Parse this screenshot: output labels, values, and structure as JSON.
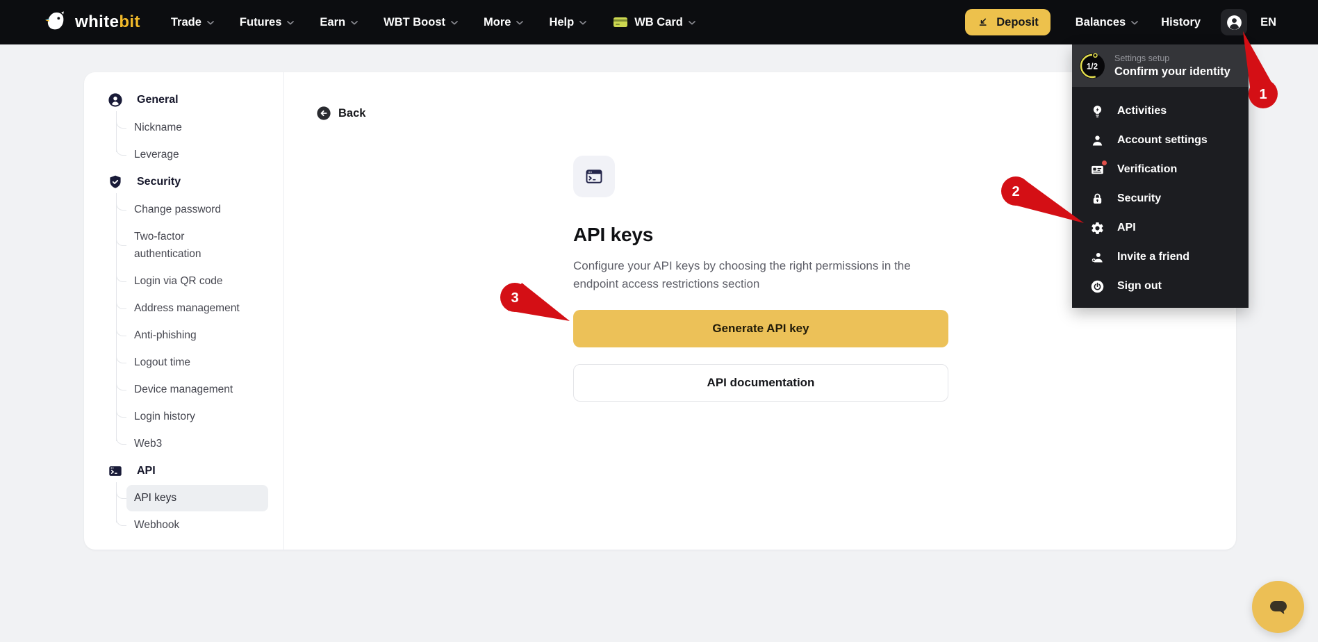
{
  "navbar": {
    "logo": {
      "white": "white",
      "bit": "bit"
    },
    "items": [
      "Trade",
      "Futures",
      "Earn",
      "WBT Boost",
      "More",
      "Help"
    ],
    "wb_card_label": "WB Card",
    "deposit_label": "Deposit",
    "balances_label": "Balances",
    "history_label": "History",
    "language": "EN"
  },
  "account_menu": {
    "progress": "1/2",
    "setup_label": "Settings setup",
    "setup_title": "Confirm your identity",
    "items": [
      {
        "label": "Activities",
        "icon": "activities-bulb-icon"
      },
      {
        "label": "Account settings",
        "icon": "person-icon"
      },
      {
        "label": "Verification",
        "icon": "id-card-icon",
        "badge": true
      },
      {
        "label": "Security",
        "icon": "lock-icon"
      },
      {
        "label": "API",
        "icon": "gear-icon"
      },
      {
        "label": "Invite a friend",
        "icon": "invite-friend-icon"
      },
      {
        "label": "Sign out",
        "icon": "power-icon"
      }
    ]
  },
  "sidebar": {
    "sections": [
      {
        "label": "General",
        "icon": "person-circle-icon",
        "children": [
          "Nickname",
          "Leverage"
        ]
      },
      {
        "label": "Security",
        "icon": "shield-check-icon",
        "children": [
          "Change password",
          "Two-factor authentication",
          "Login via QR code",
          "Address management",
          "Anti-phishing",
          "Logout time",
          "Device management",
          "Login history",
          "Web3"
        ]
      },
      {
        "label": "API",
        "icon": "terminal-icon",
        "children": [
          "API keys",
          "Webhook"
        ],
        "active_child": "API keys"
      }
    ]
  },
  "main": {
    "back_label": "Back",
    "title": "API keys",
    "description": "Configure your API keys by choosing the right permissions in the endpoint access restrictions section",
    "primary_button": "Generate API key",
    "secondary_button": "API documentation"
  },
  "annotations": {
    "step1": "1",
    "step2": "2",
    "step3": "3"
  },
  "icons": {
    "logo-bird-icon": "bird glyph",
    "chevron-down-icon": "⌄",
    "wb-card-icon": "card",
    "deposit-arrow-icon": "↙",
    "user-avatar-icon": "person",
    "activities-bulb-icon": "bulb+bolt",
    "person-icon": "person",
    "id-card-icon": "id card",
    "lock-icon": "padlock",
    "gear-icon": "⚙",
    "invite-friend-icon": "person+",
    "power-icon": "⏻",
    "person-circle-icon": "person in circle",
    "shield-check-icon": "shield ✓",
    "terminal-icon": ">_",
    "terminal-window-icon": ">_ window",
    "back-arrow-icon": "←",
    "chat-bubble-icon": "speech bubble"
  },
  "colors": {
    "accent_yellow": "#ECC158",
    "deposit_yellow": "#EDC14C",
    "annotation_red": "#D40F15",
    "navbar_bg": "#0C0D10",
    "menu_bg": "#1C1D21",
    "menu_header_bg": "#343539",
    "page_bg": "#F1F2F4",
    "navy_icon": "#191B38"
  }
}
